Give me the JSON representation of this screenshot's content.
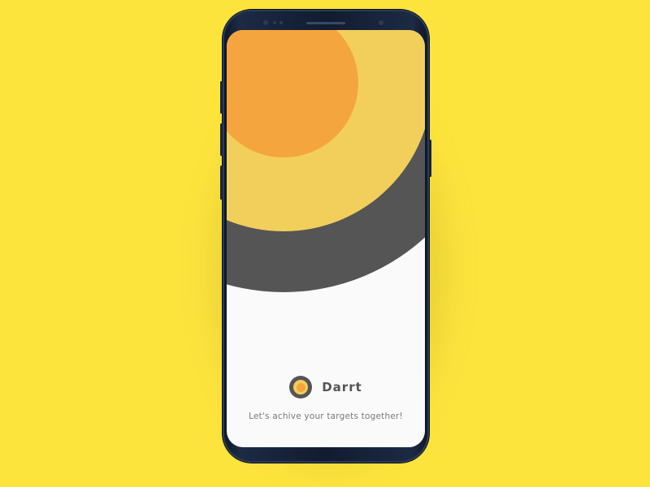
{
  "app": {
    "name": "Darrt",
    "tagline": "Let's achive your targets together!"
  },
  "colors": {
    "background": "#fde43d",
    "phone_body": "#121c30",
    "screen_bg": "#fafafa",
    "ring_outer": "#555555",
    "ring_middle": "#f2cf5b",
    "ring_inner": "#f5a53d",
    "text_dark": "#555555",
    "text_muted": "#7a7a7a"
  },
  "icons": {
    "logo": "target-logo-icon",
    "front_camera": "camera-icon",
    "sensor": "sensor-icon"
  }
}
